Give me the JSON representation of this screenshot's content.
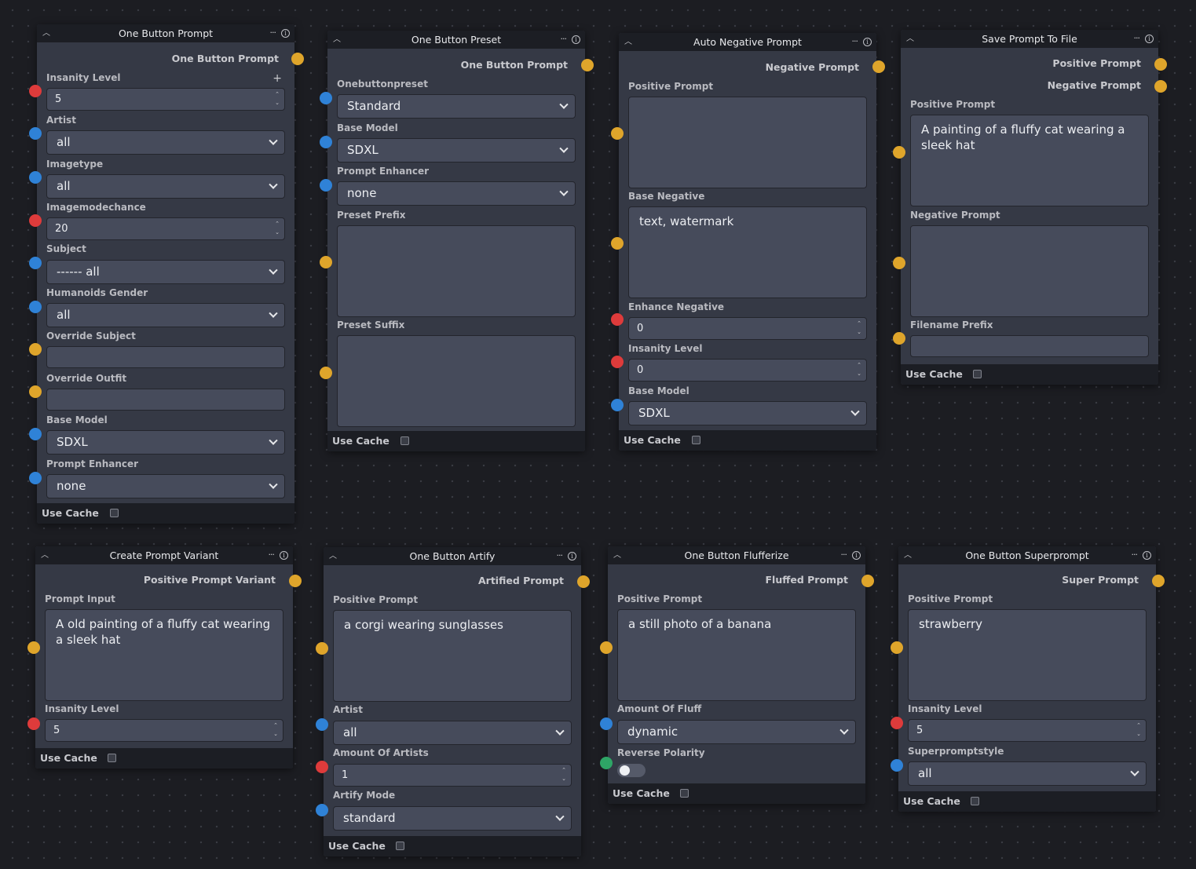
{
  "common": {
    "use_cache": "Use Cache"
  },
  "n1": {
    "title": "One Button Prompt",
    "output": "One Button Prompt",
    "insanity_label": "Insanity Level",
    "insanity": "5",
    "artist_label": "Artist",
    "artist": "all",
    "imagetype_label": "Imagetype",
    "imagetype": "all",
    "imagemodechance_label": "Imagemodechance",
    "imagemodechance": "20",
    "subject_label": "Subject",
    "subject": "------ all",
    "gender_label": "Humanoids Gender",
    "gender": "all",
    "override_subject_label": "Override Subject",
    "override_subject": "",
    "override_outfit_label": "Override Outfit",
    "override_outfit": "",
    "base_model_label": "Base Model",
    "base_model": "SDXL",
    "enhancer_label": "Prompt Enhancer",
    "enhancer": "none"
  },
  "n2": {
    "title": "One Button Preset",
    "output": "One Button Prompt",
    "preset_label": "Onebuttonpreset",
    "preset": "Standard",
    "base_model_label": "Base Model",
    "base_model": "SDXL",
    "enhancer_label": "Prompt Enhancer",
    "enhancer": "none",
    "prefix_label": "Preset Prefix",
    "prefix": "",
    "suffix_label": "Preset Suffix",
    "suffix": ""
  },
  "n3": {
    "title": "Auto Negative Prompt",
    "output": "Negative Prompt",
    "positive_label": "Positive Prompt",
    "positive": "",
    "base_negative_label": "Base Negative",
    "base_negative": "text, watermark",
    "enhance_label": "Enhance Negative",
    "enhance": "0",
    "insanity_label": "Insanity Level",
    "insanity": "0",
    "base_model_label": "Base Model",
    "base_model": "SDXL"
  },
  "n4": {
    "title": "Save Prompt To File",
    "output1": "Positive Prompt",
    "output2": "Negative Prompt",
    "positive_label": "Positive Prompt",
    "positive": "A painting of a fluffy cat wearing a sleek hat",
    "negative_label": "Negative Prompt",
    "negative": "",
    "filename_label": "Filename Prefix",
    "filename": ""
  },
  "n5": {
    "title": "Create Prompt Variant",
    "output": "Positive Prompt Variant",
    "input_label": "Prompt Input",
    "input": "A old painting of a fluffy cat wearing a sleek hat",
    "insanity_label": "Insanity Level",
    "insanity": "5"
  },
  "n6": {
    "title": "One Button Artify",
    "output": "Artified Prompt",
    "positive_label": "Positive Prompt",
    "positive": "a corgi wearing sunglasses",
    "artist_label": "Artist",
    "artist": "all",
    "amount_label": "Amount Of Artists",
    "amount": "1",
    "mode_label": "Artify Mode",
    "mode": "standard"
  },
  "n7": {
    "title": "One Button Flufferize",
    "output": "Fluffed Prompt",
    "positive_label": "Positive Prompt",
    "positive": "a still photo of a banana",
    "fluff_label": "Amount Of Fluff",
    "fluff": "dynamic",
    "reverse_label": "Reverse Polarity",
    "reverse": false
  },
  "n8": {
    "title": "One Button Superprompt",
    "output": "Super Prompt",
    "positive_label": "Positive Prompt",
    "positive": "strawberry",
    "insanity_label": "Insanity Level",
    "insanity": "5",
    "style_label": "Superpromptstyle",
    "style": "all"
  },
  "colors": {
    "string": "#dfa52b",
    "combo": "#2f82d7",
    "int": "#de3b3b",
    "boolean": "#2ea566"
  }
}
